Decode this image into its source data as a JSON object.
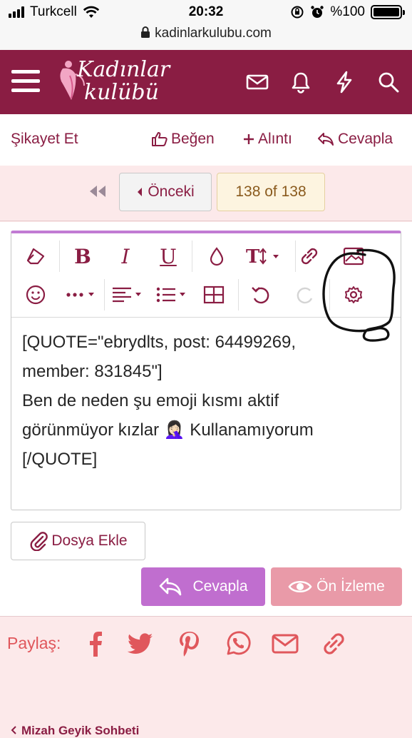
{
  "status_bar": {
    "carrier": "Turkcell",
    "time": "20:32",
    "battery": "%100"
  },
  "url_bar": {
    "url": "kadinlarkulubu.com"
  },
  "header": {
    "logo_line1": "Kadınlar",
    "logo_line2": "kulübü"
  },
  "post_actions": {
    "report": "Şikayet Et",
    "like": "Beğen",
    "quote": "Alıntı",
    "reply": "Cevapla"
  },
  "pagination": {
    "prev": "Önceki",
    "count": "138 of 138"
  },
  "editor": {
    "line1": "[QUOTE=\"ebrydlts, post: 64499269,",
    "line2": "member: 831845\"]",
    "line3": "Ben de neden şu emoji kısmı aktif",
    "line4a": "görünmüyor kızlar ",
    "emoji": "🤦🏻‍♀️",
    "line4b": " Kullanamıyorum",
    "line5": "[/QUOTE]"
  },
  "attach_button": {
    "label": "Dosya Ekle"
  },
  "reply_button": {
    "label": "Cevapla"
  },
  "preview_button": {
    "label": "Ön İzleme"
  },
  "share": {
    "label": "Paylaş:"
  },
  "bottom_link": {
    "label": "Mizah Geyik Sohbeti"
  },
  "colors": {
    "brand": "#8a1d43",
    "accent": "#c06ecf",
    "share": "#e0575c"
  }
}
